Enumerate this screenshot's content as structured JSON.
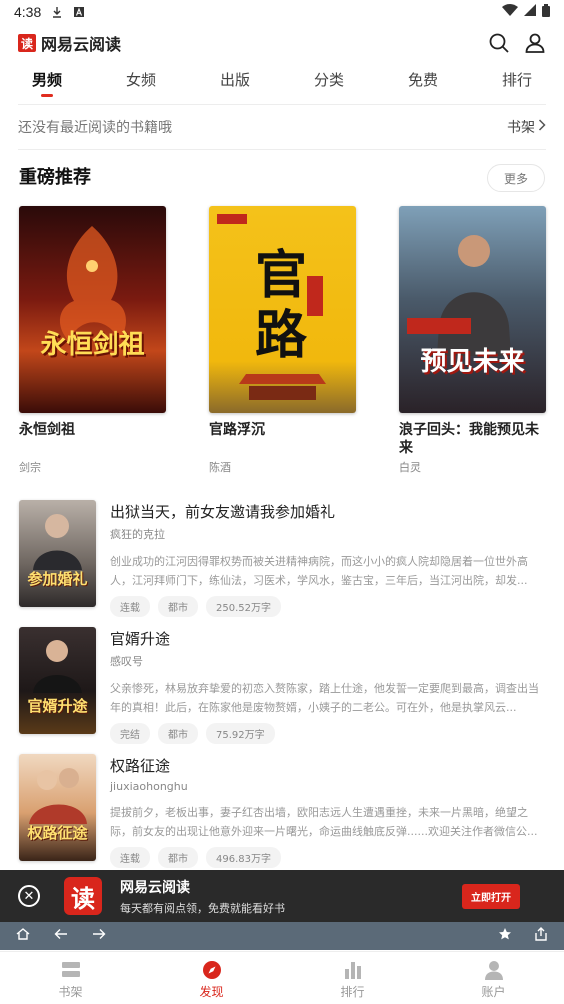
{
  "status_bar": {
    "time": "4:38"
  },
  "header": {
    "logo_glyph": "读",
    "app_name": "网易云阅读",
    "icons": [
      "search-icon",
      "account-icon"
    ]
  },
  "tabs": [
    {
      "label": "男频",
      "active": true
    },
    {
      "label": "女频",
      "active": false
    },
    {
      "label": "出版",
      "active": false
    },
    {
      "label": "分类",
      "active": false
    },
    {
      "label": "免费",
      "active": false
    },
    {
      "label": "排行",
      "active": false
    }
  ],
  "recent": {
    "empty_text": "还没有最近阅读的书籍哦",
    "shelf_label": "书架"
  },
  "featured_section": {
    "title": "重磅推荐",
    "more_label": "更多",
    "books": [
      {
        "title": "永恒剑祖",
        "author": "剑宗",
        "cover_text": "永恒剑祖"
      },
      {
        "title": "官路浮沉",
        "author": "陈酒",
        "cover_text": "官路"
      },
      {
        "title": "浪子回头：我能预见未来",
        "author": "白灵",
        "cover_text": "预见未来"
      }
    ]
  },
  "book_list": [
    {
      "title": "出狱当天，前女友邀请我参加婚礼",
      "author": "疯狂的克拉",
      "desc": "创业成功的江河因得罪权势而被关进精神病院，而这小小的疯人院却隐居着一位世外高人，江河拜师门下，练仙法，习医术，学风水，鉴古宝，三年后，当江河出院，却发...",
      "tags": [
        "连载",
        "都市",
        "250.52万字"
      ],
      "cover_text": "参加婚礼"
    },
    {
      "title": "官婿升途",
      "author": "感叹号",
      "desc": "父亲惨死，林易放弃挚爱的初恋入赘陈家，踏上仕途，他发誓一定要爬到最高，调查出当年的真相！此后，在陈家他是废物赘婿，小姨子的二老公。可在外，他是执掌风云...",
      "tags": [
        "完结",
        "都市",
        "75.92万字"
      ],
      "cover_text": "官婿升途"
    },
    {
      "title": "权路征途",
      "author": "jiuxiaohonghu",
      "desc": "提拔前夕，老板出事，妻子红杏出墙，欧阳志远人生遭遇重挫，未来一片黑暗，绝望之际，前女友的出现让他意外迎来一片曙光，命运曲线触底反弹......欢迎关注作者微信公...",
      "tags": [
        "连载",
        "都市",
        "496.83万字"
      ],
      "cover_text": "权路征途"
    }
  ],
  "promo": {
    "logo_glyph": "读",
    "name": "网易云阅读",
    "sub": "每天都有阅点领，免费就能看好书",
    "button": "立即打开"
  },
  "bottom_nav": [
    {
      "label": "书架",
      "icon": "bookshelf-icon",
      "active": false
    },
    {
      "label": "发现",
      "icon": "discover-icon",
      "active": true
    },
    {
      "label": "排行",
      "icon": "ranking-icon",
      "active": false
    },
    {
      "label": "账户",
      "icon": "account-icon",
      "active": false
    }
  ],
  "colors": {
    "accent": "#d9261c",
    "promo_bg": "#2a2a2a",
    "browser_bar": "#5b6a78"
  }
}
